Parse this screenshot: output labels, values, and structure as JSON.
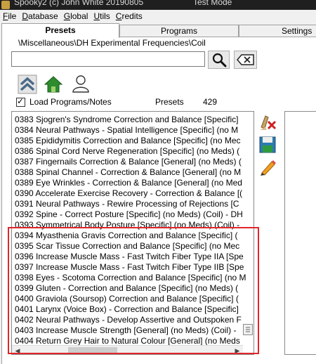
{
  "titlebar": {
    "title": "Spooky2 (c) John White 20190805",
    "mode": "Test Mode"
  },
  "menu": [
    {
      "acc": "F",
      "rest": "ile"
    },
    {
      "acc": "D",
      "rest": "atabase"
    },
    {
      "acc": "G",
      "rest": "lobal"
    },
    {
      "acc": "U",
      "rest": "tils"
    },
    {
      "acc": "C",
      "rest": "redits"
    }
  ],
  "tabs": {
    "presets": "Presets",
    "programs": "Programs",
    "settings": "Settings"
  },
  "path": "\\Miscellaneous\\DH Experimental Frequencies\\Coil",
  "search": {
    "value": "",
    "placeholder": ""
  },
  "load": {
    "checked": true,
    "label": "Load Programs/Notes"
  },
  "presets": {
    "label": "Presets",
    "count": "429"
  },
  "list_items": [
    "0383 Sjogren's Syndrome Correction and Balance [Specific]",
    "0384 Neural Pathways - Spatial Intelligence [Specific] (no M",
    "0385 Epididymitis Correction and Balance [Specific] (no Mec",
    "0386 Spinal Cord Nerve Regeneration [Specific] (no Meds) (",
    "0387 Fingernails Correction & Balance [General] (no Meds) (",
    "0388 Spinal Channel - Correction & Balance [General] (no M",
    "0389 Eye Wrinkles - Correction & Balance [General] (no Med",
    "0390 Accelerate Exercise Recovery - Correction & Balance [(",
    "0391 Neural Pathways - Rewire Processing of Rejections [C",
    "0392 Spine - Correct Posture [Specific] (no Meds) (Coil) - DH",
    "0393 Symmetrical Body Posture [Specific] (no Meds) (Coil) -",
    "0394 Myasthenia Gravis Correction and Balance [Specific] (",
    "0395 Scar Tissue Correction and Balance [Specific] (no Mec",
    "0396 Increase Muscle Mass - Fast Twitch Fiber Type IIA [Spe",
    "0397 Increase Muscle Mass - Fast Twitch Fiber Type IIB [Spe",
    "0398 Eyes - Scotoma Correction and Balance [Specific] (no M",
    "0399 Gluten - Correction and Balance [Specific] (no Meds) (",
    "0400 Graviola (Soursop) Correction and Balance [Specific] (",
    "0401 Larynx (Voice Box) - Correction and Balance [Specific]",
    "0402 Neural Pathways - Develop Assertive and Outspoken F",
    "0403 Increase Muscle Strength [General] (no Meds) (Coil) -",
    "0404 Return Grey Hair to Natural Colour [General] (no Meds"
  ],
  "colors": {
    "highlight": "#e0262b",
    "accent_green": "#2e8b2e"
  },
  "icons": {
    "search": "magnifier-icon",
    "clear": "clear-search-icon",
    "up": "up-level-icon",
    "home": "home-icon",
    "user": "user-presets-icon",
    "delete": "delete-preset-icon",
    "save": "save-preset-icon",
    "edit": "edit-preset-icon"
  }
}
